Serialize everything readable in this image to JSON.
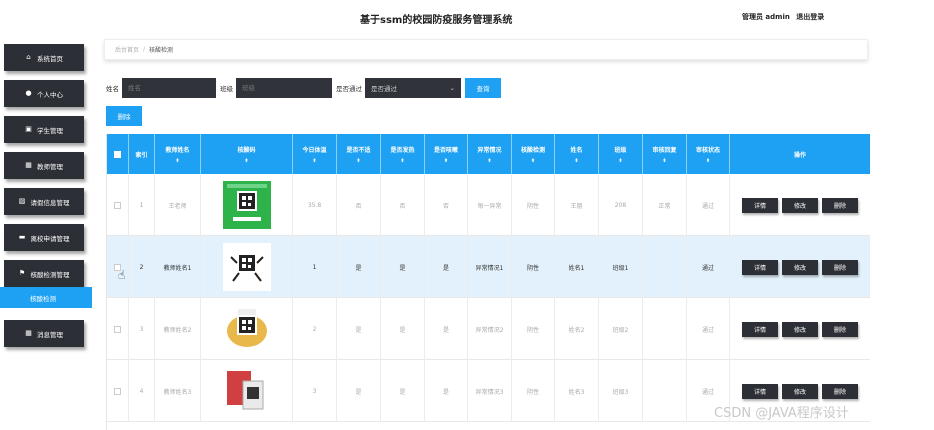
{
  "header": {
    "title": "基于ssm的校园防疫服务管理系统",
    "admin_label": "管理员 admin",
    "logout": "退出登录"
  },
  "sidebar": {
    "items": [
      {
        "label": "系统首页",
        "icon": "home-icon"
      },
      {
        "label": "个人中心",
        "icon": "user-icon"
      },
      {
        "label": "学生管理",
        "icon": "student-icon"
      },
      {
        "label": "教师管理",
        "icon": "grid-icon"
      },
      {
        "label": "请假信息管理",
        "icon": "briefcase-icon"
      },
      {
        "label": "离校申请管理",
        "icon": "ticket-icon"
      },
      {
        "label": "核酸检测管理",
        "icon": "flag-icon"
      },
      {
        "label": "消息管理",
        "icon": "grid-icon"
      }
    ],
    "active_sub": "核酸检测"
  },
  "breadcrumb": {
    "home": "后台首页",
    "current": "核酸检测"
  },
  "search": {
    "name_label": "姓名",
    "name_placeholder": "姓名",
    "class_label": "班级",
    "class_placeholder": "班级",
    "pass_label": "是否通过",
    "pass_value": "是否通过",
    "search_button": "查询"
  },
  "delete_button": "删除",
  "table": {
    "headers": [
      "",
      "索引",
      "教师姓名",
      "核酸码",
      "今日体温",
      "是否不适",
      "是否发热",
      "是否咳嗽",
      "异常情况",
      "核酸检测",
      "姓名",
      "班级",
      "审核回复",
      "审核状态",
      "操作"
    ],
    "sortable": [
      false,
      false,
      true,
      true,
      true,
      true,
      true,
      true,
      true,
      true,
      true,
      true,
      true,
      true,
      false
    ],
    "rows": [
      {
        "index": "1",
        "teacher": "王老师",
        "temp": "35.8",
        "discomfort": "否",
        "fever": "否",
        "cough": "否",
        "abnormal": "每一异常",
        "test": "阴性",
        "name": "王朋",
        "class": "208",
        "reply": "正常",
        "status": "通过",
        "qr": "green"
      },
      {
        "index": "2",
        "teacher": "教师姓名1",
        "temp": "1",
        "discomfort": "是",
        "fever": "是",
        "cough": "是",
        "abnormal": "异常情况1",
        "test": "阴性",
        "name": "姓名1",
        "class": "班级1",
        "reply": "",
        "status": "通过",
        "qr": "dance"
      },
      {
        "index": "3",
        "teacher": "教师姓名2",
        "temp": "2",
        "discomfort": "是",
        "fever": "是",
        "cough": "是",
        "abnormal": "异常情况2",
        "test": "阴性",
        "name": "姓名2",
        "class": "班级2",
        "reply": "",
        "status": "通过",
        "qr": "cartoon"
      },
      {
        "index": "4",
        "teacher": "教师姓名3",
        "temp": "3",
        "discomfort": "是",
        "fever": "是",
        "cough": "是",
        "abnormal": "异常情况3",
        "test": "阴性",
        "name": "姓名3",
        "class": "班级3",
        "reply": "",
        "status": "通过",
        "qr": "phone"
      }
    ],
    "ops": [
      "详情",
      "修改",
      "删除"
    ]
  },
  "watermark": "CSDN @JAVA程序设计"
}
